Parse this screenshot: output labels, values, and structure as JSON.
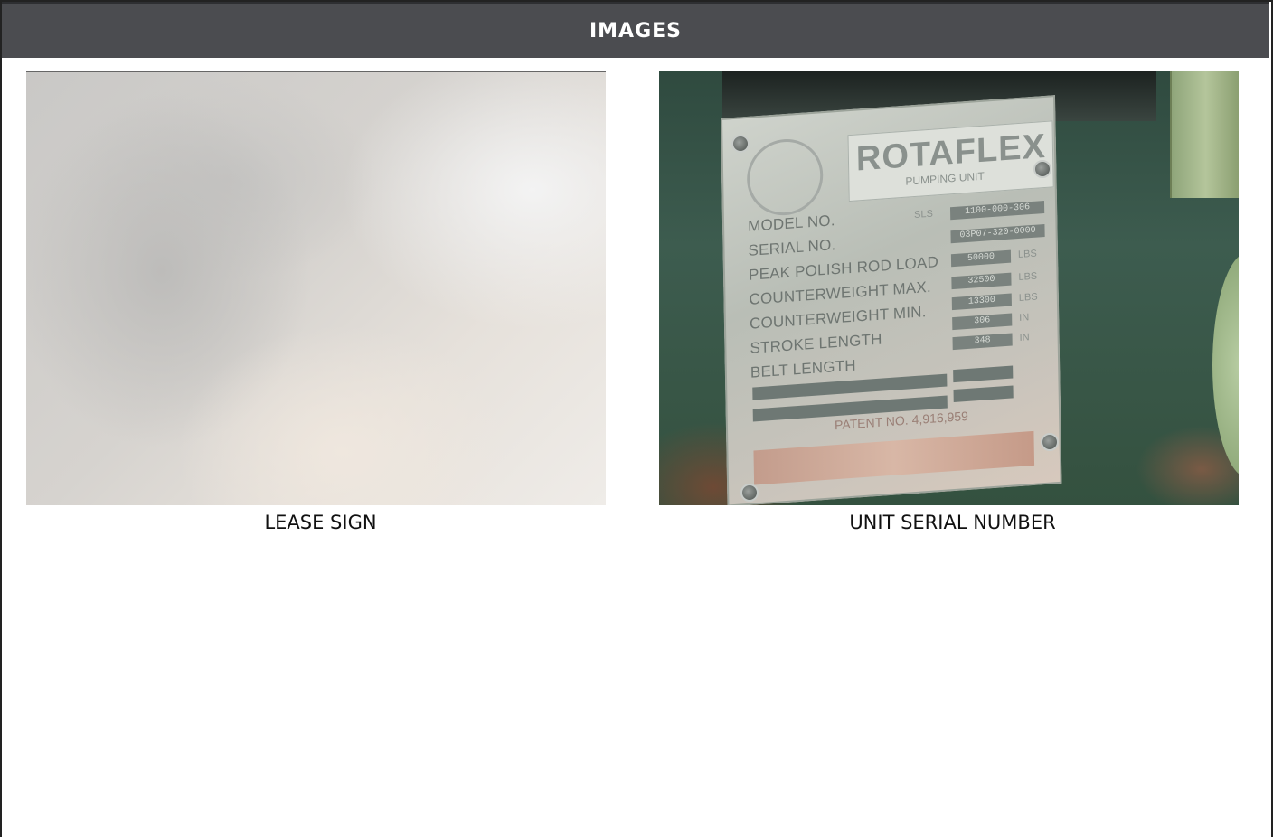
{
  "header": {
    "title": "IMAGES"
  },
  "images": [
    {
      "caption": "LEASE SIGN"
    },
    {
      "caption": "UNIT SERIAL NUMBER",
      "nameplate": {
        "brand": "ROTAFLEX",
        "subtitle": "PUMPING UNIT",
        "rows": [
          {
            "label": "MODEL NO.",
            "prefix": "SLS",
            "value": "1100-000-306",
            "unit": ""
          },
          {
            "label": "SERIAL NO.",
            "prefix": "",
            "value": "03P07-320-0000",
            "unit": ""
          },
          {
            "label": "PEAK POLISH ROD LOAD",
            "prefix": "",
            "value": "50000",
            "unit": "LBS"
          },
          {
            "label": "COUNTERWEIGHT MAX.",
            "prefix": "",
            "value": "32500",
            "unit": "LBS"
          },
          {
            "label": "COUNTERWEIGHT MIN.",
            "prefix": "",
            "value": "13300",
            "unit": "LBS"
          },
          {
            "label": "STROKE LENGTH",
            "prefix": "",
            "value": "306",
            "unit": "IN"
          },
          {
            "label": "BELT LENGTH",
            "prefix": "",
            "value": "348",
            "unit": "IN"
          }
        ],
        "patent": "PATENT NO. 4,916,959"
      }
    }
  ]
}
